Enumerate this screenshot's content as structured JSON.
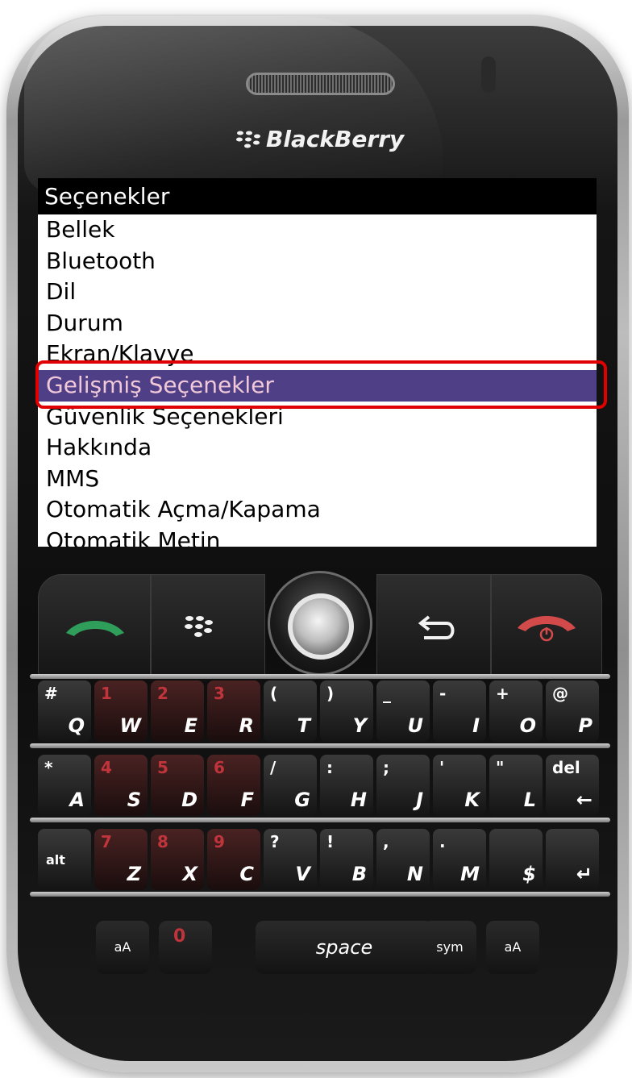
{
  "device": {
    "brand_name": "BlackBerry"
  },
  "screen": {
    "title": "Seçenekler",
    "items": [
      {
        "label": "Bellek",
        "selected": false
      },
      {
        "label": "Bluetooth",
        "selected": false
      },
      {
        "label": "Dil",
        "selected": false
      },
      {
        "label": "Durum",
        "selected": false
      },
      {
        "label": "Ekran/Klavye",
        "selected": false
      },
      {
        "label": "Gelişmiş Seçenekler",
        "selected": true
      },
      {
        "label": "Güvenlik Seçenekleri",
        "selected": false
      },
      {
        "label": "Hakkında",
        "selected": false
      },
      {
        "label": "MMS",
        "selected": false
      },
      {
        "label": "Otomatik Açma/Kapama",
        "selected": false
      },
      {
        "label": "Otomatik Metin",
        "selected": false
      }
    ]
  },
  "keyboard": {
    "row1": [
      {
        "main": "Q",
        "sub": "#",
        "red": false
      },
      {
        "main": "W",
        "sub": "1",
        "red": true
      },
      {
        "main": "E",
        "sub": "2",
        "red": true
      },
      {
        "main": "R",
        "sub": "3",
        "red": true
      },
      {
        "main": "T",
        "sub": "(",
        "red": false
      },
      {
        "main": "Y",
        "sub": ")",
        "red": false
      },
      {
        "main": "U",
        "sub": "_",
        "red": false
      },
      {
        "main": "I",
        "sub": "-",
        "red": false
      },
      {
        "main": "O",
        "sub": "+",
        "red": false
      },
      {
        "main": "P",
        "sub": "@",
        "red": false
      }
    ],
    "row2": [
      {
        "main": "A",
        "sub": "*",
        "red": false
      },
      {
        "main": "S",
        "sub": "4",
        "red": true
      },
      {
        "main": "D",
        "sub": "5",
        "red": true
      },
      {
        "main": "F",
        "sub": "6",
        "red": true
      },
      {
        "main": "G",
        "sub": "/",
        "red": false
      },
      {
        "main": "H",
        "sub": ":",
        "red": false
      },
      {
        "main": "J",
        "sub": ";",
        "red": false
      },
      {
        "main": "K",
        "sub": "'",
        "red": false
      },
      {
        "main": "L",
        "sub": "\"",
        "red": false
      },
      {
        "main": "←",
        "sub": "del",
        "red": false
      }
    ],
    "row3": [
      {
        "main": "alt",
        "sub": "",
        "red": false
      },
      {
        "main": "Z",
        "sub": "7",
        "red": true
      },
      {
        "main": "X",
        "sub": "8",
        "red": true
      },
      {
        "main": "C",
        "sub": "9",
        "red": true
      },
      {
        "main": "V",
        "sub": "?",
        "red": false
      },
      {
        "main": "B",
        "sub": "!",
        "red": false
      },
      {
        "main": "N",
        "sub": ",",
        "red": false
      },
      {
        "main": "M",
        "sub": ".",
        "red": false
      },
      {
        "main": "$",
        "sub": "",
        "red": false
      },
      {
        "main": "↵",
        "sub": "",
        "red": false
      }
    ],
    "shift_left": "aA",
    "zero_key": "0",
    "space_label": "space",
    "sym_label": "sym",
    "shift_right": "aA"
  }
}
